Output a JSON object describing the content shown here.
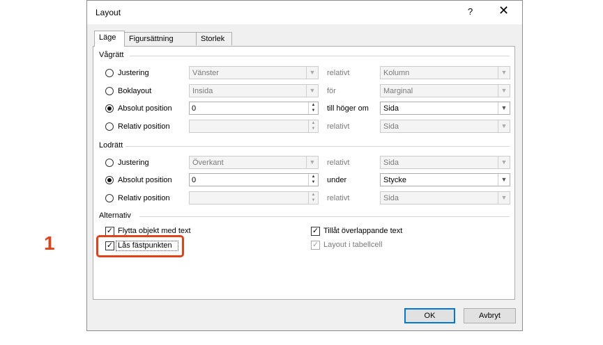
{
  "dialog": {
    "title": "Layout",
    "help": "?",
    "close": "✕"
  },
  "tabs": [
    "Läge",
    "Figursättning",
    "Storlek"
  ],
  "horizontal": {
    "label": "Vågrätt",
    "rows": [
      {
        "option": "Justering",
        "checked": false,
        "field": "Vänster",
        "relation": "relativt",
        "target": "Kolumn",
        "enabled": false
      },
      {
        "option": "Boklayout",
        "checked": false,
        "field": "Insida",
        "relation": "för",
        "target": "Marginal",
        "enabled": false
      },
      {
        "option": "Absolut position",
        "checked": true,
        "field": "0",
        "relation": "till höger om",
        "target": "Sida",
        "enabled": true
      },
      {
        "option": "Relativ position",
        "checked": false,
        "field": "",
        "relation": "relativt",
        "target": "Sida",
        "enabled": false
      }
    ]
  },
  "vertical": {
    "label": "Lodrätt",
    "rows": [
      {
        "option": "Justering",
        "checked": false,
        "field": "Överkant",
        "relation": "relativt",
        "target": "Sida",
        "enabled": false
      },
      {
        "option": "Absolut position",
        "checked": true,
        "field": "0",
        "relation": "under",
        "target": "Stycke",
        "enabled": true
      },
      {
        "option": "Relativ position",
        "checked": false,
        "field": "",
        "relation": "relativt",
        "target": "Sida",
        "enabled": false
      }
    ]
  },
  "options": {
    "label": "Alternativ",
    "move_with_text": "Flytta objekt med text",
    "lock_anchor": "Lås fästpunkten",
    "allow_overlap": "Tillåt överlappande text",
    "layout_in_cell": "Layout i tabellcell"
  },
  "buttons": {
    "ok": "OK",
    "cancel": "Avbryt"
  },
  "annotation": {
    "step": "1",
    "color": "#e0431a"
  },
  "icons": {
    "combo_arrow": "chevron-down-icon",
    "spin": "spin-arrows-icon",
    "check": "checkmark-icon"
  }
}
